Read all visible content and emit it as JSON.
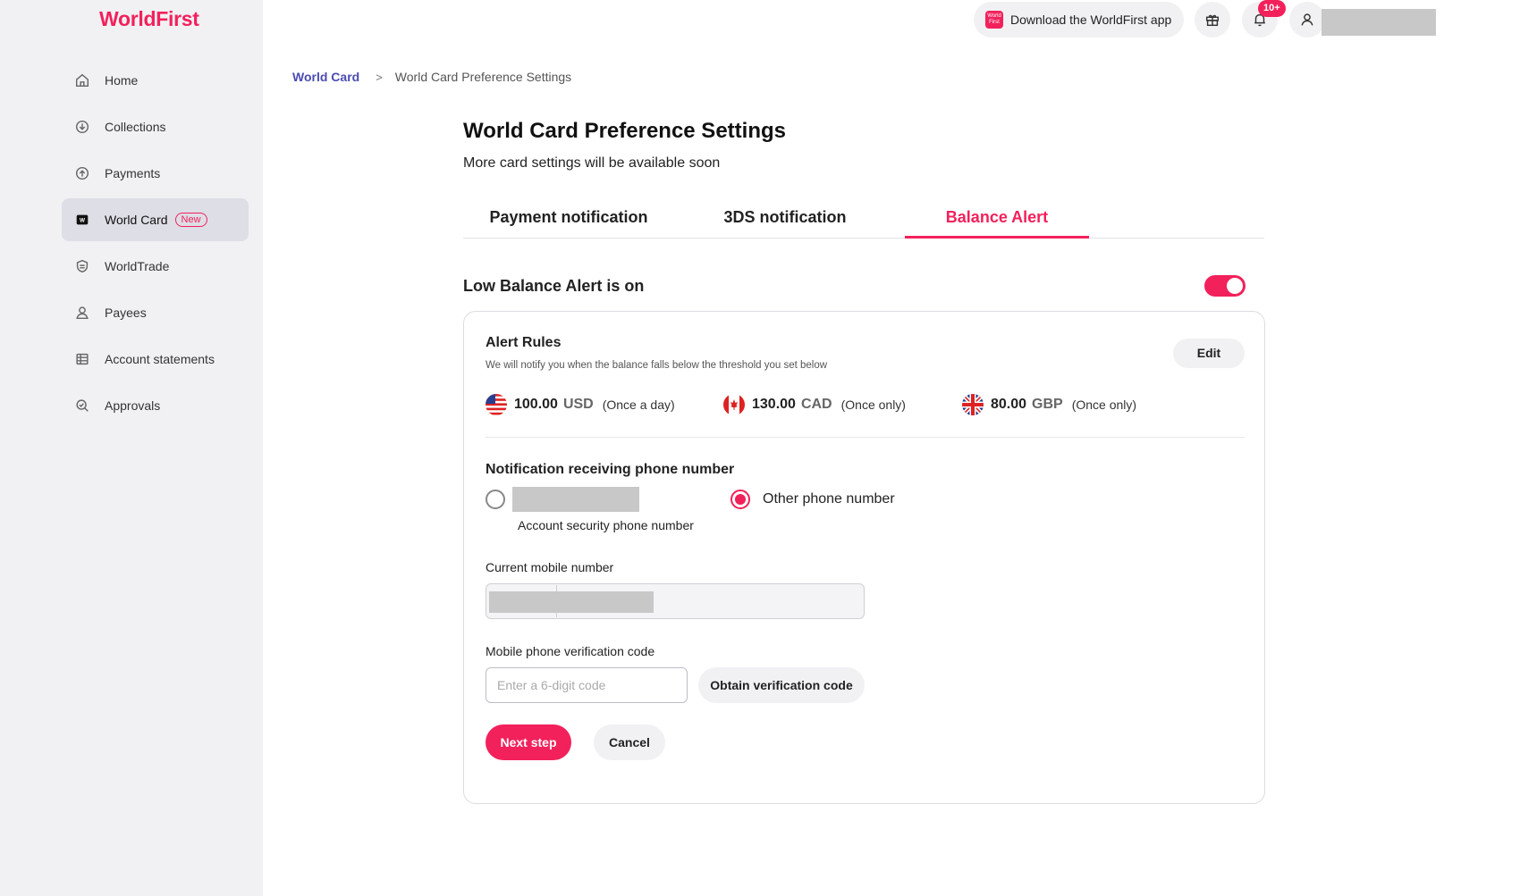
{
  "brand": {
    "logo_text": "WorldFirst",
    "accent": "#f2215b"
  },
  "sidebar": {
    "items": [
      {
        "label": "Home",
        "icon": "home-icon"
      },
      {
        "label": "Collections",
        "icon": "collections-icon"
      },
      {
        "label": "Payments",
        "icon": "payments-icon"
      },
      {
        "label": "World Card",
        "icon": "world-card-icon",
        "badge": "New",
        "active": true
      },
      {
        "label": "WorldTrade",
        "icon": "worldtrade-shield-icon"
      },
      {
        "label": "Payees",
        "icon": "payees-person-icon"
      },
      {
        "label": "Account statements",
        "icon": "statements-icon"
      },
      {
        "label": "Approvals",
        "icon": "approvals-icon"
      }
    ]
  },
  "topbar": {
    "download_app_label": "Download the WorldFirst app",
    "download_app_icon_text": "World First",
    "notification_count": "10+"
  },
  "breadcrumb": {
    "parent": "World Card",
    "separator": ">",
    "current": "World Card Preference Settings"
  },
  "page": {
    "title": "World Card Preference Settings",
    "subtitle": "More card settings will be available soon"
  },
  "tabs": [
    {
      "label": "Payment notification",
      "active": false
    },
    {
      "label": "3DS notification",
      "active": false
    },
    {
      "label": "Balance Alert",
      "active": true
    }
  ],
  "low_balance": {
    "label": "Low Balance Alert is on",
    "enabled": true
  },
  "alert_rules": {
    "title": "Alert Rules",
    "description": "We will notify you when the balance falls below the threshold you set below",
    "edit_label": "Edit",
    "items": [
      {
        "amount": "100.00",
        "currency": "USD",
        "frequency": "(Once a day)",
        "flag": "us-flag-icon"
      },
      {
        "amount": "130.00",
        "currency": "CAD",
        "frequency": "(Once only)",
        "flag": "ca-flag-icon"
      },
      {
        "amount": "80.00",
        "currency": "GBP",
        "frequency": "(Once only)",
        "flag": "gb-flag-icon"
      }
    ]
  },
  "phone": {
    "title": "Notification receiving phone number",
    "account_security_label": "Account security phone number",
    "other_label": "Other phone number",
    "selected": "other"
  },
  "current_mobile": {
    "label": "Current mobile number"
  },
  "verification": {
    "label": "Mobile phone verification code",
    "placeholder": "Enter a 6-digit code",
    "obtain_label": "Obtain verification code"
  },
  "actions": {
    "next_label": "Next step",
    "cancel_label": "Cancel"
  }
}
